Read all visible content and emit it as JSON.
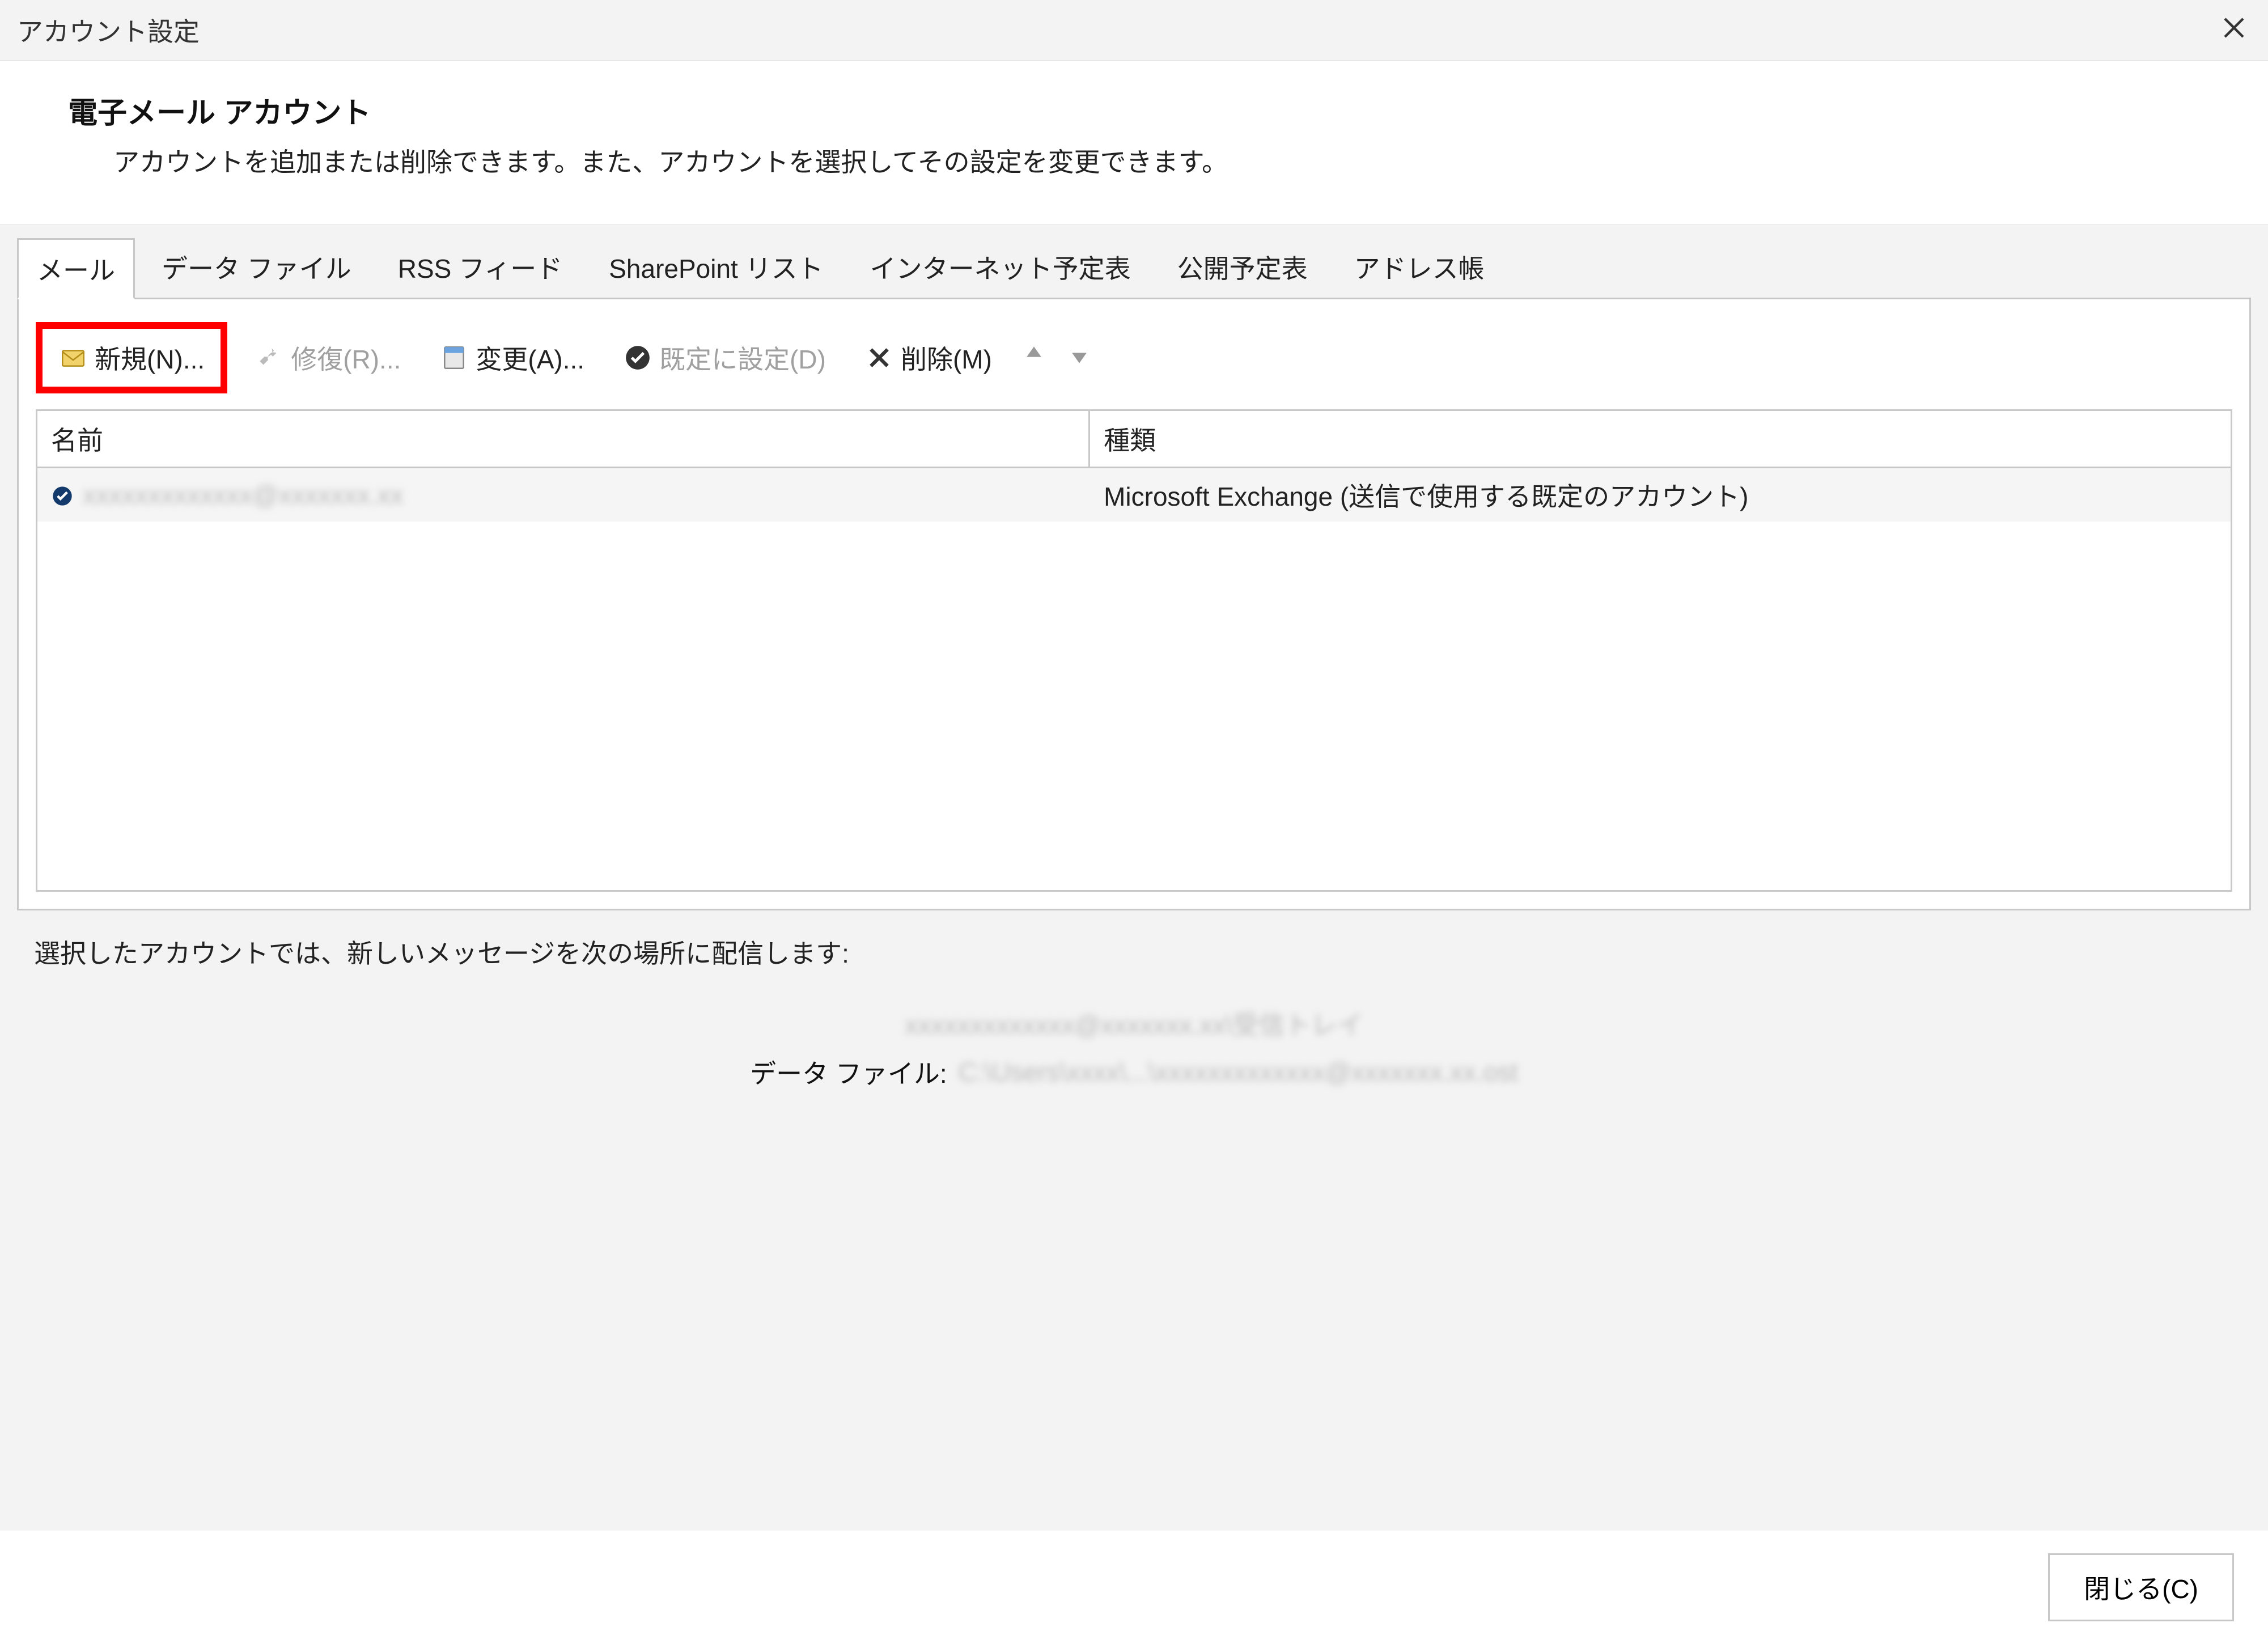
{
  "window": {
    "title": "アカウント設定"
  },
  "header": {
    "title": "電子メール アカウント",
    "description": "アカウントを追加または削除できます。また、アカウントを選択してその設定を変更できます。"
  },
  "tabs": [
    {
      "label": "メール",
      "active": true
    },
    {
      "label": "データ ファイル"
    },
    {
      "label": "RSS フィード"
    },
    {
      "label": "SharePoint リスト"
    },
    {
      "label": "インターネット予定表"
    },
    {
      "label": "公開予定表"
    },
    {
      "label": "アドレス帳"
    }
  ],
  "toolbar": {
    "new_label": "新規(N)...",
    "repair_label": "修復(R)...",
    "change_label": "変更(A)...",
    "set_default_label": "既定に設定(D)",
    "remove_label": "削除(M)"
  },
  "table": {
    "col_name": "名前",
    "col_type": "種類",
    "rows": [
      {
        "name_masked": "xxxxxxxxxxxxx@xxxxxxx.xx",
        "type": "Microsoft Exchange (送信で使用する既定のアカウント)"
      }
    ]
  },
  "delivery": {
    "caption": "選択したアカウントでは、新しいメッセージを次の場所に配信します:",
    "line1_masked": "xxxxxxxxxxxxx@xxxxxxx.xx\\受信トレイ",
    "datafile_label": "データ ファイル:",
    "datafile_value_masked": "C:\\Users\\xxxx\\...\\xxxxxxxxxxxxx@xxxxxxx.xx.ost"
  },
  "footer": {
    "close_label": "閉じる(C)"
  }
}
